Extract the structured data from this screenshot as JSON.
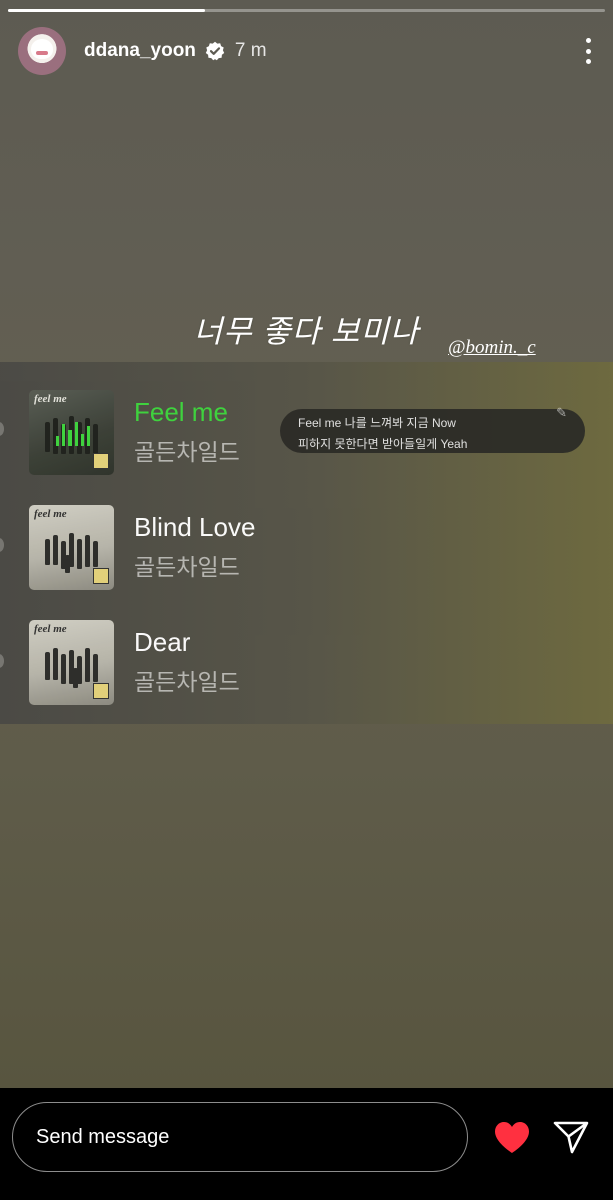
{
  "story": {
    "progress_fraction": 0.33,
    "header": {
      "username": "ddana_yoon",
      "time": "7 m"
    },
    "caption": "너무 좋다 보미나",
    "mention": "@bomin._c",
    "songs": [
      {
        "title": "Feel me",
        "artist": "골든차일드",
        "playing": true,
        "cover_title": "feel me"
      },
      {
        "title": "Blind Love",
        "artist": "골든차일드",
        "playing": false,
        "cover_title": "feel me"
      },
      {
        "title": "Dear",
        "artist": "골든차일드",
        "playing": false,
        "cover_title": "feel me"
      }
    ],
    "lyrics": {
      "line1": "Feel me 나를 느껴봐 지금 Now",
      "line2": "피하지 못한다면 받아들일게 Yeah"
    }
  },
  "footer": {
    "message_placeholder": "Send message"
  },
  "colors": {
    "playing_accent": "#3ed63e",
    "heart": "#ff3040"
  },
  "icons": [
    "verified-badge-icon",
    "more-options-icon",
    "equalizer-icon",
    "pencil-icon",
    "heart-icon",
    "send-icon"
  ]
}
